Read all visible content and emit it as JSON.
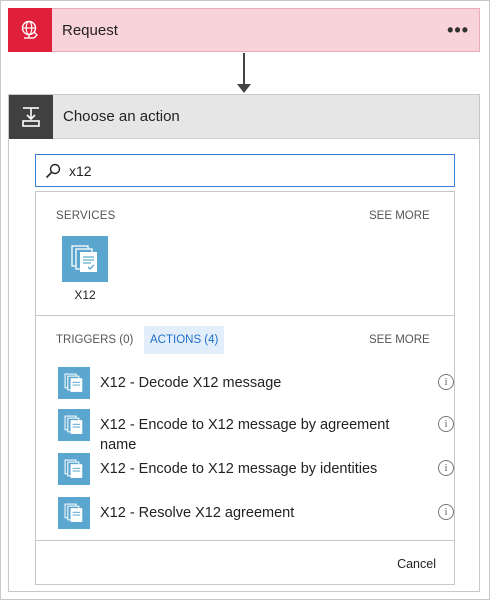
{
  "request_card": {
    "title": "Request",
    "more_label": "•••",
    "icon": "globe-request-icon",
    "accent_color": "#e0203a",
    "background_color": "#f9d3da"
  },
  "action_card": {
    "title": "Choose an action",
    "icon": "action-step-icon",
    "search": {
      "value": "x12",
      "placeholder": ""
    },
    "services": {
      "header": "SERVICES",
      "see_more": "SEE MORE",
      "items": [
        {
          "label": "X12",
          "icon": "x12-service-icon"
        }
      ]
    },
    "tabs": [
      {
        "label": "TRIGGERS (0)",
        "selected": false
      },
      {
        "label": "ACTIONS (4)",
        "selected": true
      }
    ],
    "list_see_more": "SEE MORE",
    "actions": [
      {
        "label": "X12 - Decode X12 message",
        "info": "i"
      },
      {
        "label": "X12 - Encode to X12 message by agreement name",
        "info": "i"
      },
      {
        "label": "X12 - Encode to X12 message by identities",
        "info": "i"
      },
      {
        "label": "X12 - Resolve X12 agreement",
        "info": "i"
      }
    ],
    "cancel_label": "Cancel",
    "accent_color": "#1e6fc9",
    "service_color": "#5aa6cf"
  }
}
